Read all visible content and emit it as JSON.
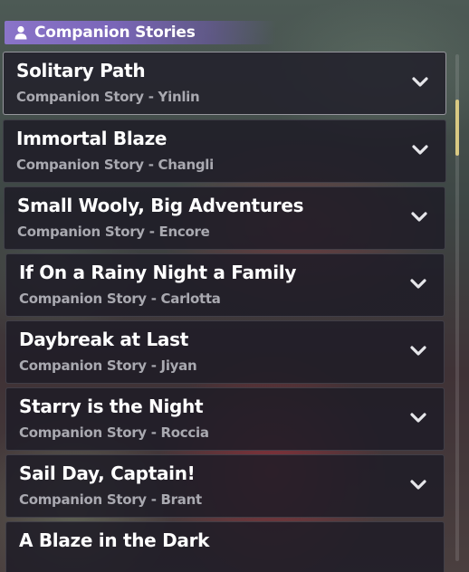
{
  "header": {
    "icon": "person-icon",
    "title": "Companion Stories",
    "accent_color": "#8a74c9"
  },
  "stories": [
    {
      "title": "Solitary Path",
      "subtitle": "Companion Story - Yinlin",
      "selected": true
    },
    {
      "title": "Immortal Blaze",
      "subtitle": "Companion Story - Changli"
    },
    {
      "title": "Small Wooly, Big Adventures",
      "subtitle": "Companion Story - Encore"
    },
    {
      "title": "If On a Rainy Night a Family",
      "subtitle": "Companion Story - Carlotta"
    },
    {
      "title": "Daybreak at Last",
      "subtitle": "Companion Story - Jiyan"
    },
    {
      "title": "Starry is the Night",
      "subtitle": "Companion Story - Roccia"
    },
    {
      "title": "Sail Day, Captain!",
      "subtitle": "Companion Story - Brant"
    },
    {
      "title": "A Blaze in the Dark",
      "subtitle": ""
    }
  ],
  "expand_icon": "chevron-down-icon",
  "scrollbar_color": "#d9c983"
}
